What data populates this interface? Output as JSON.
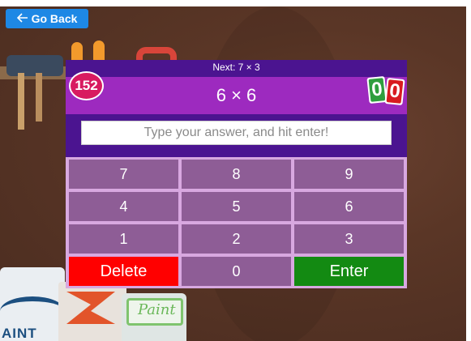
{
  "nav": {
    "back_label": "Go Back",
    "back_icon": "arrow-left-icon"
  },
  "background": {
    "can_label_left": "AINT",
    "can_label_right": "Paint"
  },
  "quiz": {
    "next_text": "Next: 7 × 3",
    "question": "6 × 6",
    "score": "152",
    "streak": [
      "0",
      "0"
    ],
    "answer_placeholder": "Type your answer, and hit enter!",
    "answer_value": ""
  },
  "keypad": {
    "keys": [
      "7",
      "8",
      "9",
      "4",
      "5",
      "6",
      "1",
      "2",
      "3",
      "Delete",
      "0",
      "Enter"
    ]
  },
  "colors": {
    "panel": "#4b1490",
    "question_bar": "#9d2abf",
    "score_badge": "#d81b60",
    "keypad_bg": "#d8a8e0",
    "key": "#8e5d96",
    "delete": "#ff0000",
    "enter": "#138a12",
    "back_button": "#1e88e5"
  }
}
